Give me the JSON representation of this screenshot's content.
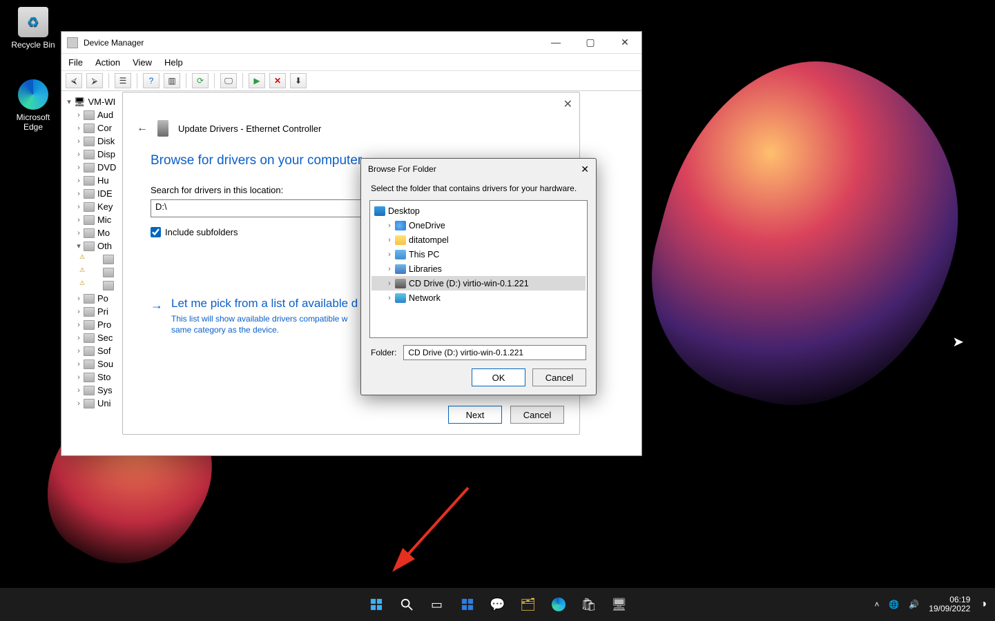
{
  "desktop": {
    "recycle": "Recycle Bin",
    "edge": "Microsoft Edge"
  },
  "taskbar": {
    "time": "06:19",
    "date": "19/09/2022"
  },
  "dm": {
    "title": "Device Manager",
    "menu": {
      "file": "File",
      "action": "Action",
      "view": "View",
      "help": "Help"
    },
    "root": "VM-WI",
    "nodes": [
      "Aud",
      "Cor",
      "Disk",
      "Disp",
      "DVD",
      "Hu",
      "IDE",
      "Key",
      "Mic",
      "Mo",
      "Oth",
      "Po",
      "Pri",
      "Pro",
      "Sec",
      "Sof",
      "Sou",
      "Sto",
      "Sys",
      "Uni"
    ]
  },
  "wizard": {
    "title": "Update Drivers - Ethernet Controller",
    "heading": "Browse for drivers on your computer",
    "searchLabel": "Search for drivers in this location:",
    "path": "D:\\",
    "includeSub": "Include subfolders",
    "linkTitle": "Let me pick from a list of available d",
    "linkDesc1": "This list will show available drivers compatible w",
    "linkDesc2": "same category as the device.",
    "next": "Next",
    "cancel": "Cancel"
  },
  "bff": {
    "title": "Browse For Folder",
    "msg": "Select the folder that contains drivers for your hardware.",
    "tree": {
      "root": "Desktop",
      "items": [
        {
          "label": "OneDrive",
          "icon": "ic-cloud"
        },
        {
          "label": "ditatompel",
          "icon": "ic-folder"
        },
        {
          "label": "This PC",
          "icon": "ic-pc"
        },
        {
          "label": "Libraries",
          "icon": "ic-lib"
        },
        {
          "label": "CD Drive (D:) virtio-win-0.1.221",
          "icon": "ic-cd",
          "selected": true
        },
        {
          "label": "Network",
          "icon": "ic-net"
        }
      ]
    },
    "folderLabel": "Folder:",
    "folderValue": "CD Drive (D:) virtio-win-0.1.221",
    "ok": "OK",
    "cancel": "Cancel"
  }
}
